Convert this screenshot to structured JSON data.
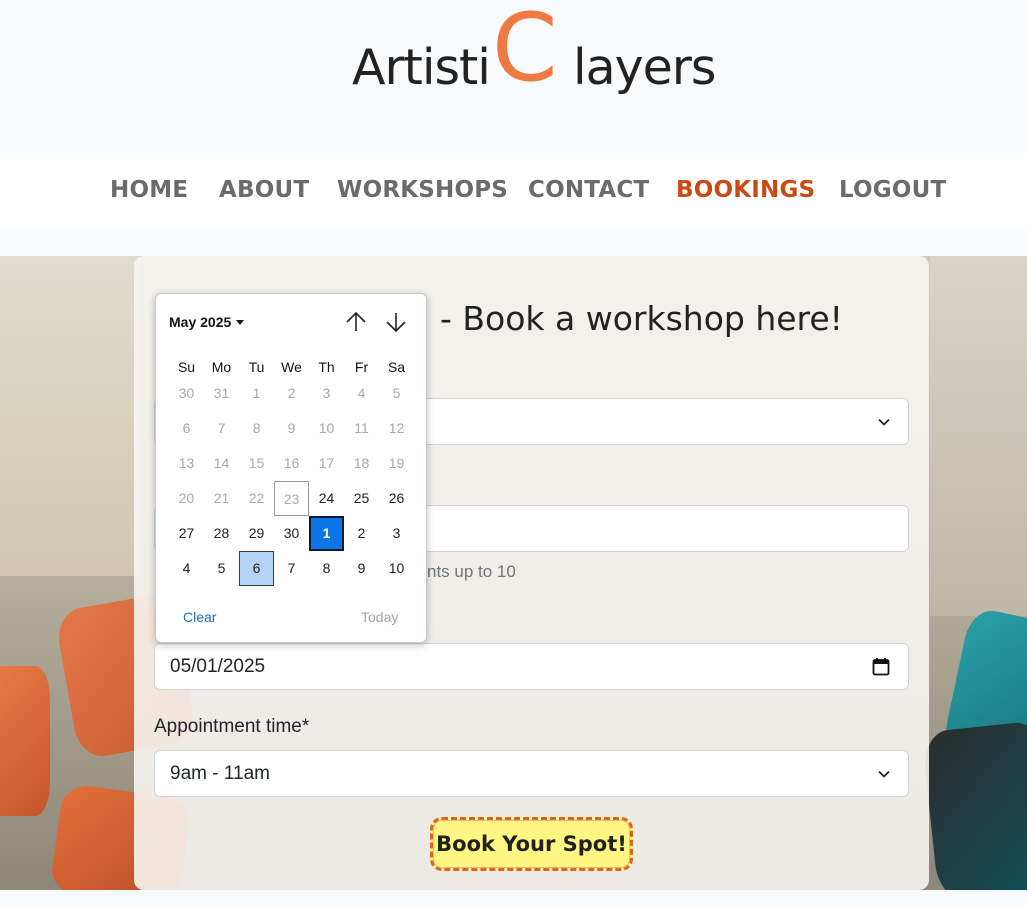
{
  "logo": {
    "part1": "Artisti",
    "big_letter": "C",
    "part2": "layers"
  },
  "nav": [
    {
      "label": "HOME",
      "active": false
    },
    {
      "label": "ABOUT",
      "active": false
    },
    {
      "label": "WORKSHOPS",
      "active": false
    },
    {
      "label": "CONTACT",
      "active": false
    },
    {
      "label": "BOOKINGS",
      "active": true
    },
    {
      "label": "LOGOUT",
      "active": false
    }
  ],
  "form": {
    "title": "- Book a workshop here!",
    "participants_help": "nts up to 10",
    "date_value": "05/01/2025",
    "time_label": "Appointment time*",
    "time_value": "9am - 11am",
    "submit_label": "Book Your Spot!"
  },
  "datepicker": {
    "month_label": "May 2025",
    "weekdays": [
      "Su",
      "Mo",
      "Tu",
      "We",
      "Th",
      "Fr",
      "Sa"
    ],
    "weeks": [
      [
        {
          "d": "30",
          "o": 1
        },
        {
          "d": "31",
          "o": 1
        },
        {
          "d": "1",
          "o": 1
        },
        {
          "d": "2",
          "o": 1
        },
        {
          "d": "3",
          "o": 1
        },
        {
          "d": "4",
          "o": 1
        },
        {
          "d": "5",
          "o": 1
        }
      ],
      [
        {
          "d": "6",
          "o": 1
        },
        {
          "d": "7",
          "o": 1
        },
        {
          "d": "8",
          "o": 1
        },
        {
          "d": "9",
          "o": 1
        },
        {
          "d": "10",
          "o": 1
        },
        {
          "d": "11",
          "o": 1
        },
        {
          "d": "12",
          "o": 1
        }
      ],
      [
        {
          "d": "13",
          "o": 1
        },
        {
          "d": "14",
          "o": 1
        },
        {
          "d": "15",
          "o": 1
        },
        {
          "d": "16",
          "o": 1
        },
        {
          "d": "17",
          "o": 1
        },
        {
          "d": "18",
          "o": 1
        },
        {
          "d": "19",
          "o": 1
        }
      ],
      [
        {
          "d": "20",
          "o": 1
        },
        {
          "d": "21",
          "o": 1
        },
        {
          "d": "22",
          "o": 1
        },
        {
          "d": "23",
          "o": 1,
          "s": "today-box"
        },
        {
          "d": "24",
          "o": 0
        },
        {
          "d": "25",
          "o": 0
        },
        {
          "d": "26",
          "o": 0
        }
      ],
      [
        {
          "d": "27",
          "o": 0
        },
        {
          "d": "28",
          "o": 0
        },
        {
          "d": "29",
          "o": 0
        },
        {
          "d": "30",
          "o": 0
        },
        {
          "d": "1",
          "o": 0,
          "s": "selected"
        },
        {
          "d": "2",
          "o": 0
        },
        {
          "d": "3",
          "o": 0
        }
      ],
      [
        {
          "d": "4",
          "o": 0
        },
        {
          "d": "5",
          "o": 0
        },
        {
          "d": "6",
          "o": 0,
          "s": "hover"
        },
        {
          "d": "7",
          "o": 0
        },
        {
          "d": "8",
          "o": 0
        },
        {
          "d": "9",
          "o": 0
        },
        {
          "d": "10",
          "o": 0
        }
      ]
    ],
    "clear_label": "Clear",
    "today_label": "Today"
  },
  "colors": {
    "accent": "#f07841",
    "nav_active": "#cc4a12",
    "selected_day": "#0b75e6",
    "button_bg": "#fff782",
    "button_border": "#d9652a"
  },
  "icons": [
    "chevron-down-icon",
    "calendar-icon",
    "arrow-up-icon",
    "arrow-down-icon"
  ]
}
